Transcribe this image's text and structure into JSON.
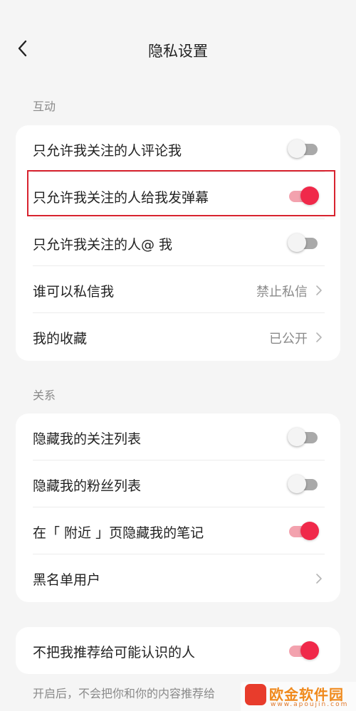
{
  "header": {
    "title": "隐私设置",
    "back_icon": "chevron-left-icon"
  },
  "sections": [
    {
      "label": "互动",
      "rows": [
        {
          "label": "只允许我关注的人评论我",
          "type": "toggle",
          "on": false
        },
        {
          "label": "只允许我关注的人给我发弹幕",
          "type": "toggle",
          "on": true
        },
        {
          "label": "只允许我关注的人@ 我",
          "type": "toggle",
          "on": false
        },
        {
          "label": "谁可以私信我",
          "type": "link",
          "value": "禁止私信"
        },
        {
          "label": "我的收藏",
          "type": "link",
          "value": "已公开"
        }
      ]
    },
    {
      "label": "关系",
      "rows": [
        {
          "label": "隐藏我的关注列表",
          "type": "toggle",
          "on": false
        },
        {
          "label": "隐藏我的粉丝列表",
          "type": "toggle",
          "on": false
        },
        {
          "label": "在「 附近 」页隐藏我的笔记",
          "type": "toggle",
          "on": true
        },
        {
          "label": "黑名单用户",
          "type": "link",
          "value": ""
        }
      ]
    },
    {
      "label": "",
      "rows": [
        {
          "label": "不把我推荐给可能认识的人",
          "type": "toggle",
          "on": true
        }
      ]
    }
  ],
  "footnote": "开启后，不会把你和你的内容推荐给",
  "watermark": {
    "title": "欧金软件园",
    "url": "www.apoujin.com"
  },
  "colors": {
    "accent": "#f0294a",
    "highlight_border": "#d8232f",
    "background": "#f5f5f5"
  }
}
